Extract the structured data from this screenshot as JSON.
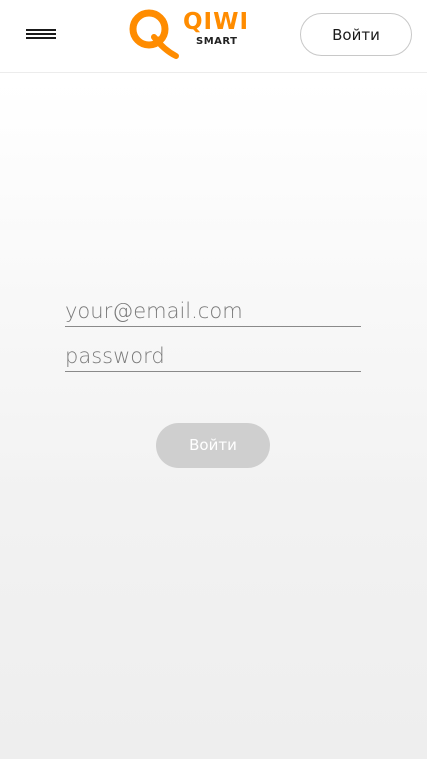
{
  "header": {
    "logo": {
      "brand": "QIWI",
      "sub": "SMART",
      "icon": "qiwi-logo-icon",
      "color": "#ff8c00"
    },
    "menu_icon": "hamburger-menu-icon",
    "login_label": "Войти"
  },
  "form": {
    "email_placeholder": "your@email.com",
    "password_placeholder": "password",
    "submit_label": "Войти",
    "submit_disabled_color": "#cfcfcf"
  }
}
